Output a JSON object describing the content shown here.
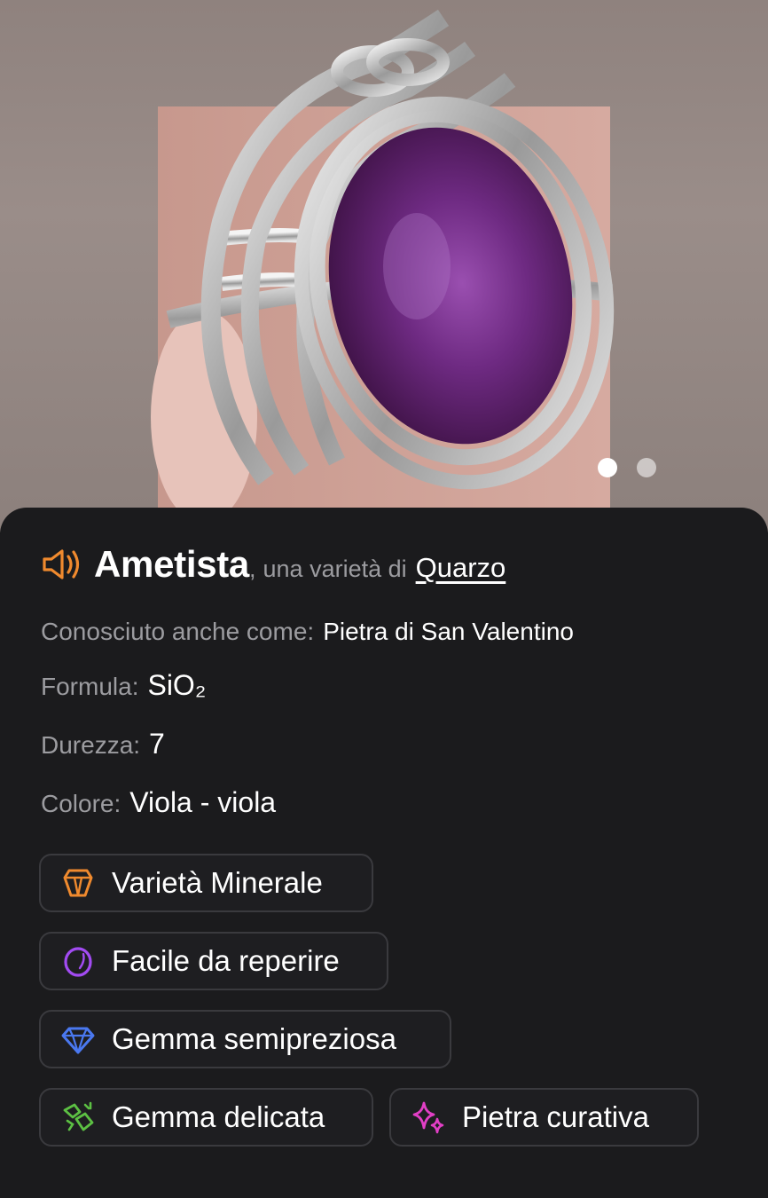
{
  "hero": {
    "slides_total": 2,
    "active_slide": 1
  },
  "mineral": {
    "name": "Ametista",
    "comma": ",",
    "variety_text": "una varietà di",
    "parent_link": "Quarzo"
  },
  "properties": {
    "aka_label": "Conosciuto anche come:",
    "aka_value": "Pietra di San Valentino",
    "formula_label": "Formula:",
    "formula_value": "SiO₂",
    "hardness_label": "Durezza:",
    "hardness_value": "7",
    "color_label": "Colore:",
    "color_value": "Viola - viola"
  },
  "tags": [
    {
      "label": "Varietà Minerale",
      "icon": "crystal-icon",
      "color": "#f08a2e"
    },
    {
      "label": "Facile da reperire",
      "icon": "stone-icon",
      "color": "#a24bf2"
    },
    {
      "label": "Gemma semipreziosa",
      "icon": "diamond-icon",
      "color": "#4a78f0"
    },
    {
      "label": "Gemma delicata",
      "icon": "broken-gem-icon",
      "color": "#5cc043"
    },
    {
      "label": "Pietra curativa",
      "icon": "sparkles-icon",
      "color": "#e23fc6"
    }
  ],
  "colors": {
    "accent_orange": "#f08a2e",
    "sheet_bg": "#1b1b1d",
    "muted_text": "#9c9ca0"
  }
}
